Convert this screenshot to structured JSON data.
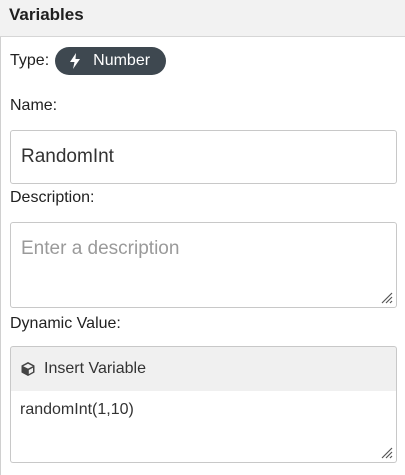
{
  "panel": {
    "title": "Variables"
  },
  "type": {
    "label": "Type:",
    "value": "Number",
    "icon": "bolt-icon"
  },
  "name": {
    "label": "Name:",
    "value": "RandomInt"
  },
  "description": {
    "label": "Description:",
    "value": "",
    "placeholder": "Enter a description"
  },
  "dynamic_value": {
    "label": "Dynamic Value:",
    "insert_button_label": "Insert Variable",
    "insert_icon": "cube-icon",
    "value": "randomInt(1,10)"
  },
  "colors": {
    "pill_bg": "#3e4850",
    "header_bg": "#f2f2f2",
    "border": "#c8c8c8"
  }
}
